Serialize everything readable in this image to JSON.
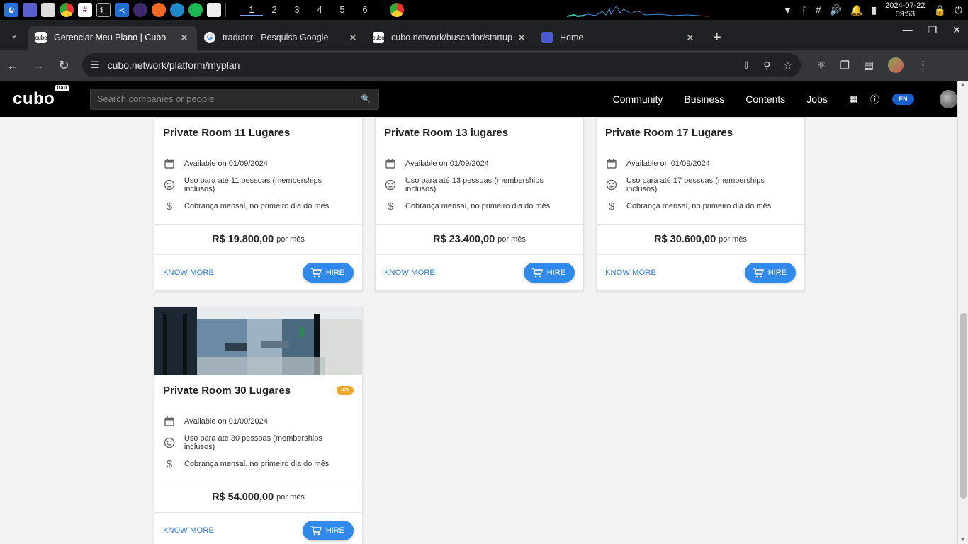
{
  "taskbar": {
    "workspaces": [
      "1",
      "2",
      "3",
      "4",
      "5",
      "6"
    ],
    "date": "2024-07-22",
    "time": "09:53"
  },
  "tabs": [
    {
      "title": "Gerenciar Meu Plano | Cubo",
      "favicon": "cubo-favicon"
    },
    {
      "title": "tradutor - Pesquisa Google",
      "favicon": "google-favicon"
    },
    {
      "title": "cubo.network/buscador/startup",
      "favicon": "cubo-favicon"
    },
    {
      "title": "Home",
      "favicon": "home-favicon"
    }
  ],
  "address_bar": {
    "url": "cubo.network/platform/myplan"
  },
  "site": {
    "logo": "cubo",
    "logo_badge": "itaú",
    "search_placeholder": "Search companies or people",
    "menu": [
      "Community",
      "Business",
      "Contents",
      "Jobs"
    ],
    "lang": "EN"
  },
  "cards": [
    {
      "title": "Private Room 11 Lugares",
      "available": "Available on 01/09/2024",
      "usage": "Uso para até 11 pessoas (memberships inclusos)",
      "billing": "Cobrança mensal, no primeiro dia do mês",
      "price": "R$ 19.800,00",
      "period": "por mês",
      "know_more": "KNOW MORE",
      "hire": "HIRE"
    },
    {
      "title": "Private Room 13 lugares",
      "available": "Available on 01/09/2024",
      "usage": "Uso para até 13 pessoas (memberships inclusos)",
      "billing": "Cobrança mensal, no primeiro dia do mês",
      "price": "R$ 23.400,00",
      "period": "por mês",
      "know_more": "KNOW MORE",
      "hire": "HIRE"
    },
    {
      "title": "Private Room 17 Lugares",
      "available": "Available on 01/09/2024",
      "usage": "Uso para até 17 pessoas (memberships inclusos)",
      "billing": "Cobrança mensal, no primeiro dia do mês",
      "price": "R$ 30.600,00",
      "period": "por mês",
      "know_more": "KNOW MORE",
      "hire": "HIRE"
    },
    {
      "title": "Private Room 30 Lugares",
      "badge": "NEW",
      "available": "Available on 01/09/2024",
      "usage": "Uso para até 30 pessoas (memberships inclusos)",
      "billing": "Cobrança mensal, no primeiro dia do mês",
      "price": "R$ 54.000,00",
      "period": "por mês",
      "know_more": "KNOW MORE",
      "hire": "HIRE"
    }
  ],
  "colors": {
    "accent": "#2f8aeb",
    "link": "#2f7ad8",
    "badge_new": "#f5a623",
    "header_bg": "#000000"
  }
}
